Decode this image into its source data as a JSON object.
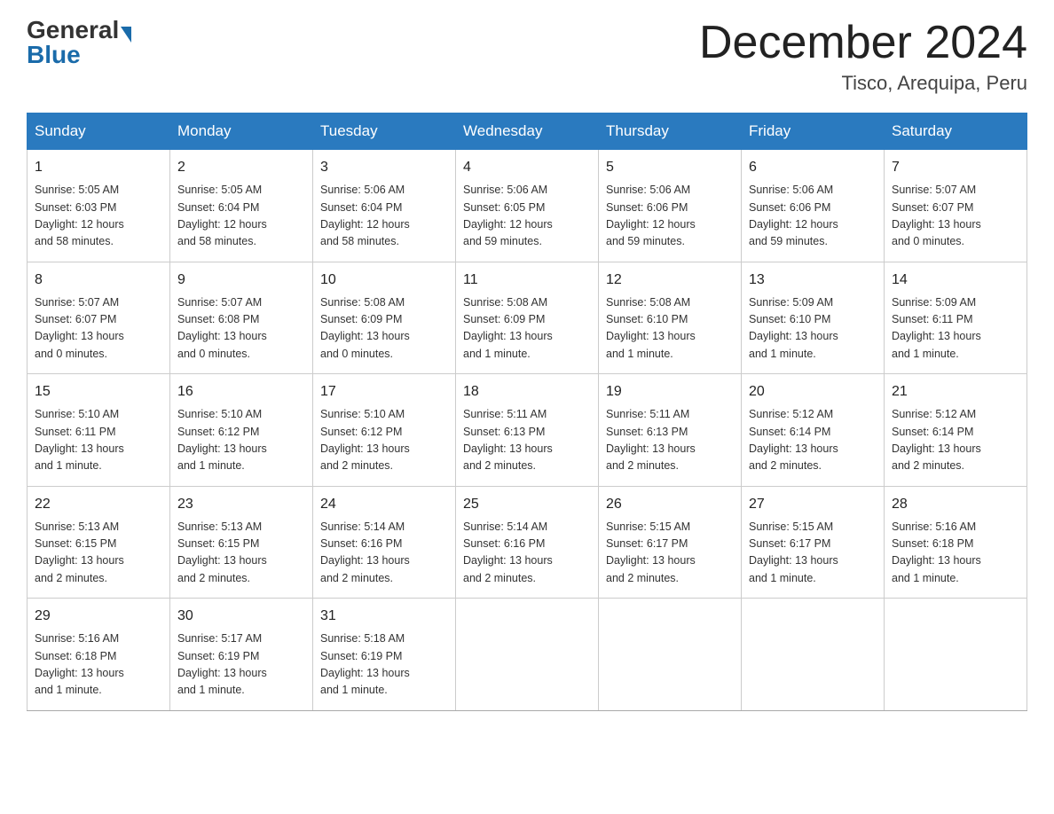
{
  "header": {
    "logo_general": "General",
    "logo_blue": "Blue",
    "month_year": "December 2024",
    "location": "Tisco, Arequipa, Peru"
  },
  "weekdays": [
    "Sunday",
    "Monday",
    "Tuesday",
    "Wednesday",
    "Thursday",
    "Friday",
    "Saturday"
  ],
  "weeks": [
    [
      {
        "day": "1",
        "info": "Sunrise: 5:05 AM\nSunset: 6:03 PM\nDaylight: 12 hours\nand 58 minutes."
      },
      {
        "day": "2",
        "info": "Sunrise: 5:05 AM\nSunset: 6:04 PM\nDaylight: 12 hours\nand 58 minutes."
      },
      {
        "day": "3",
        "info": "Sunrise: 5:06 AM\nSunset: 6:04 PM\nDaylight: 12 hours\nand 58 minutes."
      },
      {
        "day": "4",
        "info": "Sunrise: 5:06 AM\nSunset: 6:05 PM\nDaylight: 12 hours\nand 59 minutes."
      },
      {
        "day": "5",
        "info": "Sunrise: 5:06 AM\nSunset: 6:06 PM\nDaylight: 12 hours\nand 59 minutes."
      },
      {
        "day": "6",
        "info": "Sunrise: 5:06 AM\nSunset: 6:06 PM\nDaylight: 12 hours\nand 59 minutes."
      },
      {
        "day": "7",
        "info": "Sunrise: 5:07 AM\nSunset: 6:07 PM\nDaylight: 13 hours\nand 0 minutes."
      }
    ],
    [
      {
        "day": "8",
        "info": "Sunrise: 5:07 AM\nSunset: 6:07 PM\nDaylight: 13 hours\nand 0 minutes."
      },
      {
        "day": "9",
        "info": "Sunrise: 5:07 AM\nSunset: 6:08 PM\nDaylight: 13 hours\nand 0 minutes."
      },
      {
        "day": "10",
        "info": "Sunrise: 5:08 AM\nSunset: 6:09 PM\nDaylight: 13 hours\nand 0 minutes."
      },
      {
        "day": "11",
        "info": "Sunrise: 5:08 AM\nSunset: 6:09 PM\nDaylight: 13 hours\nand 1 minute."
      },
      {
        "day": "12",
        "info": "Sunrise: 5:08 AM\nSunset: 6:10 PM\nDaylight: 13 hours\nand 1 minute."
      },
      {
        "day": "13",
        "info": "Sunrise: 5:09 AM\nSunset: 6:10 PM\nDaylight: 13 hours\nand 1 minute."
      },
      {
        "day": "14",
        "info": "Sunrise: 5:09 AM\nSunset: 6:11 PM\nDaylight: 13 hours\nand 1 minute."
      }
    ],
    [
      {
        "day": "15",
        "info": "Sunrise: 5:10 AM\nSunset: 6:11 PM\nDaylight: 13 hours\nand 1 minute."
      },
      {
        "day": "16",
        "info": "Sunrise: 5:10 AM\nSunset: 6:12 PM\nDaylight: 13 hours\nand 1 minute."
      },
      {
        "day": "17",
        "info": "Sunrise: 5:10 AM\nSunset: 6:12 PM\nDaylight: 13 hours\nand 2 minutes."
      },
      {
        "day": "18",
        "info": "Sunrise: 5:11 AM\nSunset: 6:13 PM\nDaylight: 13 hours\nand 2 minutes."
      },
      {
        "day": "19",
        "info": "Sunrise: 5:11 AM\nSunset: 6:13 PM\nDaylight: 13 hours\nand 2 minutes."
      },
      {
        "day": "20",
        "info": "Sunrise: 5:12 AM\nSunset: 6:14 PM\nDaylight: 13 hours\nand 2 minutes."
      },
      {
        "day": "21",
        "info": "Sunrise: 5:12 AM\nSunset: 6:14 PM\nDaylight: 13 hours\nand 2 minutes."
      }
    ],
    [
      {
        "day": "22",
        "info": "Sunrise: 5:13 AM\nSunset: 6:15 PM\nDaylight: 13 hours\nand 2 minutes."
      },
      {
        "day": "23",
        "info": "Sunrise: 5:13 AM\nSunset: 6:15 PM\nDaylight: 13 hours\nand 2 minutes."
      },
      {
        "day": "24",
        "info": "Sunrise: 5:14 AM\nSunset: 6:16 PM\nDaylight: 13 hours\nand 2 minutes."
      },
      {
        "day": "25",
        "info": "Sunrise: 5:14 AM\nSunset: 6:16 PM\nDaylight: 13 hours\nand 2 minutes."
      },
      {
        "day": "26",
        "info": "Sunrise: 5:15 AM\nSunset: 6:17 PM\nDaylight: 13 hours\nand 2 minutes."
      },
      {
        "day": "27",
        "info": "Sunrise: 5:15 AM\nSunset: 6:17 PM\nDaylight: 13 hours\nand 1 minute."
      },
      {
        "day": "28",
        "info": "Sunrise: 5:16 AM\nSunset: 6:18 PM\nDaylight: 13 hours\nand 1 minute."
      }
    ],
    [
      {
        "day": "29",
        "info": "Sunrise: 5:16 AM\nSunset: 6:18 PM\nDaylight: 13 hours\nand 1 minute."
      },
      {
        "day": "30",
        "info": "Sunrise: 5:17 AM\nSunset: 6:19 PM\nDaylight: 13 hours\nand 1 minute."
      },
      {
        "day": "31",
        "info": "Sunrise: 5:18 AM\nSunset: 6:19 PM\nDaylight: 13 hours\nand 1 minute."
      },
      {
        "day": "",
        "info": ""
      },
      {
        "day": "",
        "info": ""
      },
      {
        "day": "",
        "info": ""
      },
      {
        "day": "",
        "info": ""
      }
    ]
  ]
}
